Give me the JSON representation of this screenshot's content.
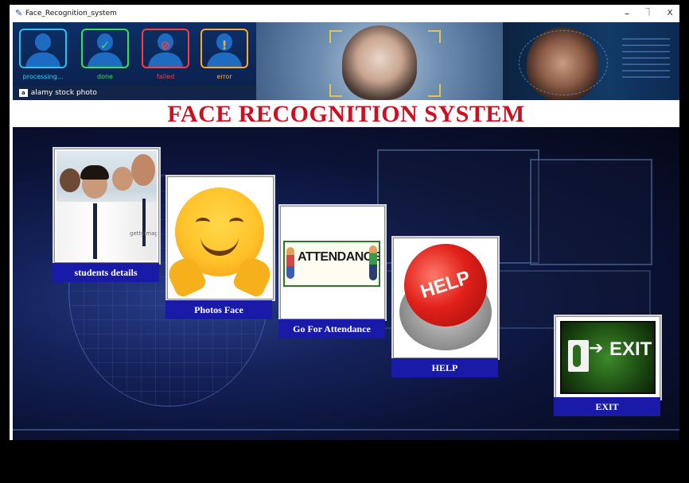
{
  "window": {
    "title": "Face_Recognition_system",
    "app_icon": "feather-icon",
    "controls": {
      "minimize": "–",
      "maximize": "⏋",
      "close": "X"
    }
  },
  "banner": {
    "stages": [
      {
        "label": "processing...",
        "color": "#2fd3ff",
        "icon": "user-scan-icon"
      },
      {
        "label": "done",
        "color": "#3ae05a",
        "icon": "check-icon"
      },
      {
        "label": "failed",
        "color": "#ff3b3b",
        "icon": "no-icon"
      },
      {
        "label": "error",
        "color": "#ffa928",
        "icon": "exclamation-icon"
      }
    ],
    "watermark": "alamy stock photo",
    "watermark_badge": "a"
  },
  "page_title": "FACE RECOGNITION SYSTEM",
  "tiles": [
    {
      "id": "students",
      "label": "students details",
      "image": "students-photo"
    },
    {
      "id": "photos",
      "label": "Photos Face",
      "image": "hugging-face-emoji"
    },
    {
      "id": "attendance",
      "label": "Go For Attendance",
      "image": "attendance-sign",
      "image_text": "ATTENDANCE"
    },
    {
      "id": "help",
      "label": "HELP",
      "image": "help-button",
      "image_text": "HELP"
    },
    {
      "id": "exit",
      "label": "EXIT",
      "image": "exit-sign",
      "image_text": "EXIT"
    }
  ],
  "students_watermark": "gettyimages",
  "colors": {
    "title_red": "#cc1020",
    "label_blue": "#1a1aa8",
    "background_navy": "#0b1236"
  }
}
